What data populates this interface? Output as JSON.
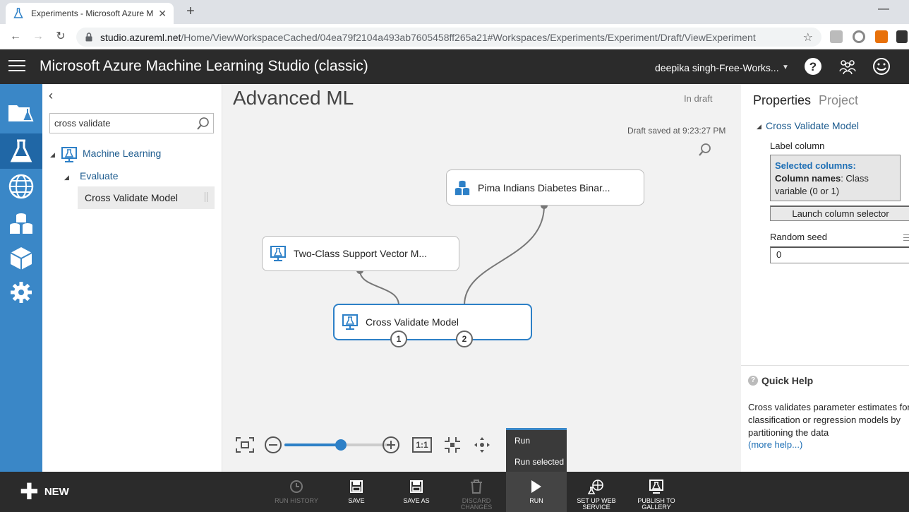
{
  "browser": {
    "tab_title": "Experiments - Microsoft Azure M",
    "tab_close": "✕",
    "new_tab": "+",
    "url_host": "studio.azureml.net",
    "url_path": "/Home/ViewWorkspaceCached/04ea79f2104a493ab7605458ff265a21#Workspaces/Experiments/Experiment/Draft/ViewExperiment"
  },
  "app": {
    "title": "Microsoft Azure Machine Learning Studio (classic)",
    "workspace": "deepika singh-Free-Works...",
    "colors": {
      "header": "#2b2b2b",
      "rail": "#3a87c7",
      "accent": "#2d80c7"
    }
  },
  "palette": {
    "search_value": "cross validate",
    "tree": {
      "category": "Machine Learning",
      "subcategory": "Evaluate",
      "item": "Cross Validate Model"
    }
  },
  "canvas": {
    "experiment_title": "Advanced ML",
    "status": "In draft",
    "saved_text": "Draft saved at 9:23:27 PM",
    "nodes": {
      "dataset": "Pima Indians Diabetes Binar...",
      "svm": "Two-Class Support Vector M...",
      "cv": "Cross Validate Model"
    },
    "ports": [
      "1",
      "2"
    ],
    "zoom_reset": "1:1",
    "zoom_level": 0.53,
    "run_menu": [
      "Run",
      "Run selected"
    ]
  },
  "properties": {
    "tab_properties": "Properties",
    "tab_project": "Project",
    "section": "Cross Validate Model",
    "label_column": "Label column",
    "selected_columns_hdr": "Selected columns:",
    "column_names_label": "Column names",
    "column_names_value": ": Class variable (0 or 1)",
    "launch_btn": "Launch column selector",
    "random_seed_label": "Random seed",
    "random_seed_value": "0"
  },
  "quick_help": {
    "title": "Quick Help",
    "text": "Cross validates parameter estimates for classification or regression models by partitioning the data",
    "link": "(more help...)"
  },
  "bottom": {
    "new_label": "NEW",
    "commands": [
      {
        "label": "RUN HISTORY"
      },
      {
        "label": "SAVE"
      },
      {
        "label": "SAVE AS"
      },
      {
        "label": "DISCARD CHANGES"
      },
      {
        "label": "RUN"
      },
      {
        "label": "SET UP WEB SERVICE"
      },
      {
        "label": "PUBLISH TO GALLERY"
      }
    ]
  }
}
